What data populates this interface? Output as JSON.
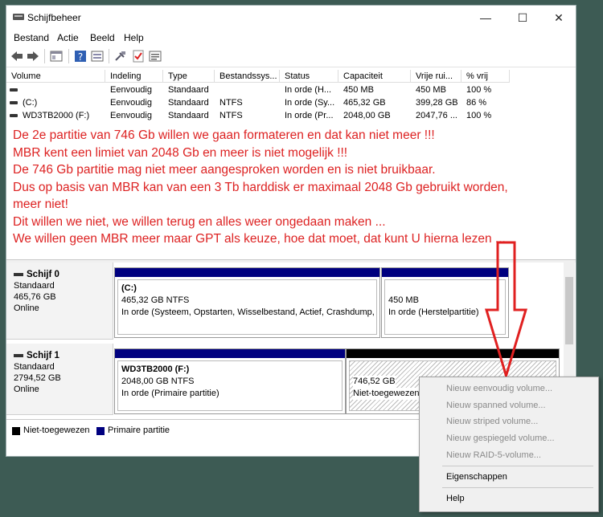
{
  "window": {
    "title": "Schijfbeheer",
    "controls": {
      "minimize": "—",
      "maximize": "☐",
      "close": "✕"
    }
  },
  "menu": [
    "Bestand",
    "Actie",
    "Beeld",
    "Help"
  ],
  "volume_table": {
    "columns": [
      "Volume",
      "Indeling",
      "Type",
      "Bestandssys...",
      "Status",
      "Capaciteit",
      "Vrije rui...",
      "% vrij"
    ],
    "rows": [
      [
        "",
        "Eenvoudig",
        "Standaard",
        "",
        "In orde (H...",
        "450 MB",
        "450 MB",
        "100 %"
      ],
      [
        "(C:)",
        "Eenvoudig",
        "Standaard",
        "NTFS",
        "In orde (Sy...",
        "465,32 GB",
        "399,28 GB",
        "86 %"
      ],
      [
        "WD3TB2000 (F:)",
        "Eenvoudig",
        "Standaard",
        "NTFS",
        "In orde (Pr...",
        "2048,00 GB",
        "2047,76 ...",
        "100 %"
      ]
    ]
  },
  "annotation": [
    "De 2e partitie van 746 Gb willen we gaan formateren en dat kan niet meer !!!",
    "MBR kent een limiet van 2048 Gb en meer is niet mogelijk !!!",
    "De 746 Gb partitie mag niet meer aangesproken worden en is niet bruikbaar.",
    "Dus op basis van MBR kan van een 3 Tb harddisk er maximaal 2048 Gb gebruikt worden,",
    "meer niet!",
    "Dit willen we niet, we willen terug en alles weer ongedaan maken ...",
    "We willen geen MBR meer maar GPT als keuze, hoe dat moet, dat kunt U hierna lezen ..."
  ],
  "disks": [
    {
      "name": "Schijf 0",
      "type": "Standaard",
      "size": "465,76 GB",
      "status": "Online",
      "partitions": [
        {
          "title": "(C:)",
          "size": "465,32 GB NTFS",
          "status": "In orde (Systeem, Opstarten, Wisselbestand, Actief, Crashdump,"
        },
        {
          "title": "",
          "size": "450 MB",
          "status": "In orde (Herstelpartitie)"
        }
      ]
    },
    {
      "name": "Schijf 1",
      "type": "Standaard",
      "size": "2794,52 GB",
      "status": "Online",
      "partitions": [
        {
          "title": "WD3TB2000  (F:)",
          "size": "2048,00 GB NTFS",
          "status": "In orde (Primaire partitie)"
        },
        {
          "title": "",
          "size": "746,52 GB",
          "status": "Niet-toegewezen"
        }
      ]
    }
  ],
  "legend": [
    {
      "label": "Niet-toegewezen",
      "color": "#000000"
    },
    {
      "label": "Primaire partitie",
      "color": "#00007f"
    }
  ],
  "context_menu": {
    "disabled_items": [
      "Nieuw eenvoudig volume...",
      "Nieuw spanned volume...",
      "Nieuw striped volume...",
      "Nieuw gespiegeld volume...",
      "Nieuw RAID-5-volume..."
    ],
    "properties": "Eigenschappen",
    "help": "Help"
  },
  "colors": {
    "primary_partition": "#00007f",
    "unallocated": "#000000",
    "annotation": "#dd2222",
    "background": "#3d5b54"
  }
}
